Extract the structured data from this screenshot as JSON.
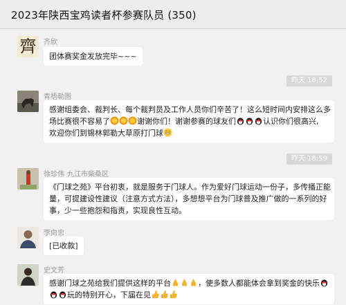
{
  "header": {
    "title": "2023年陕西宝鸡读者杯参赛队员 (350)"
  },
  "messages": [
    {
      "sender": "齐欣",
      "avatar_text": "齊",
      "text": "团体赛奖金发放完毕~~~"
    },
    {
      "time": "昨天 18:52"
    },
    {
      "sender": "青梧勒图",
      "line1": "感谢组委会、裁判长、每个裁判员及工作人员你们辛苦了！这么短时间内安排这么多",
      "line2a": "场比赛很不容易了",
      "line2b": "谢谢你们！谢谢参赛的球友们",
      "line2c": "认识你们很高兴,",
      "line3a": "欢迎你们到锡林郭勒大草原打门球"
    },
    {
      "time": "昨天 18:59"
    },
    {
      "sender": "徐珍伟",
      "location": "九江市柴桑区",
      "line1": "《门球之苑》平台初衷，就是服务于门球人。作为爱好门球运动一份子，多传播正能",
      "line2": "量，可提建设性建议（注意方式方法），多想想平台为门球普及推广做的一系列的好",
      "line3": "事，少一些抱怨和指责，实现良性互动。"
    },
    {
      "sender": "李向忠",
      "text": "[已收款]"
    },
    {
      "sender": "史文芳",
      "line1a": "感谢门球之苑给我们提供这样的平台",
      "line1b": "，使多数人都能体会拿到奖金的快乐",
      "line2a": "玩的特别开心，下届在见"
    }
  ],
  "icons": {
    "sun": "sun-emoji-icon",
    "penguin": "qq-penguin-emoji-icon",
    "grin": "grin-emoji-icon",
    "pray": "pray-emoji-icon",
    "thumbs": "thumbs-up-emoji-icon"
  }
}
